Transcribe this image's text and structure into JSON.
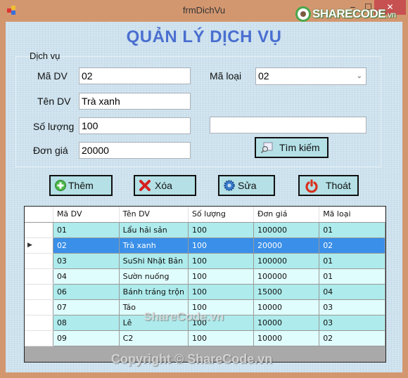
{
  "window": {
    "title": "frmDichVu",
    "minimize_label": "‒",
    "maximize_label": "☐",
    "close_label": "✕",
    "logo_text_main": "SHARECODE",
    "logo_text_suffix": ".vn"
  },
  "form": {
    "heading": "QUẢN LÝ DỊCH VỤ",
    "group_label": "Dịch vụ",
    "fields": {
      "ma_dv": {
        "label": "Mã DV",
        "value": "02"
      },
      "ten_dv": {
        "label": "Tên DV",
        "value": "Trà xanh"
      },
      "so_luong": {
        "label": "Số lượng",
        "value": "100"
      },
      "don_gia": {
        "label": "Đơn giá",
        "value": "20000"
      },
      "ma_loai": {
        "label": "Mã loại",
        "value": "02"
      },
      "search": {
        "value": ""
      }
    },
    "buttons": {
      "search": "Tìm kiếm",
      "add": "Thêm",
      "delete": "Xóa",
      "edit": "Sửa",
      "exit": "Thoát"
    }
  },
  "grid": {
    "columns": [
      "Mã DV",
      "Tên DV",
      "Số lượng",
      "Đơn giá",
      "Mã loại"
    ],
    "current_row_marker": "▶",
    "selected_index": 1,
    "rows": [
      [
        "01",
        "Lẩu hải sản",
        "100",
        "100000",
        "01"
      ],
      [
        "02",
        "Trà xanh",
        "100",
        "20000",
        "02"
      ],
      [
        "03",
        "SuShi Nhật Bản",
        "100",
        "100000",
        "01"
      ],
      [
        "04",
        "Sườn nuống",
        "100",
        "100000",
        "01"
      ],
      [
        "06",
        "Bánh tráng trộn",
        "100",
        "15000",
        "04"
      ],
      [
        "07",
        "Táo",
        "100",
        "10000",
        "03"
      ],
      [
        "08",
        "Lê",
        "100",
        "10000",
        "03"
      ],
      [
        "09",
        "C2",
        "100",
        "10000",
        "02"
      ]
    ]
  },
  "watermarks": {
    "center": "ShareCode.vn",
    "bottom": "Copyright © ShareCode.vn"
  },
  "colors": {
    "titlebar": "#d39770",
    "heading": "#4a6fd0",
    "button_bg": "#b4e0e6",
    "row_odd": "#aeebec",
    "row_even": "#e0fdfd",
    "row_selected": "#3a8fe8"
  }
}
